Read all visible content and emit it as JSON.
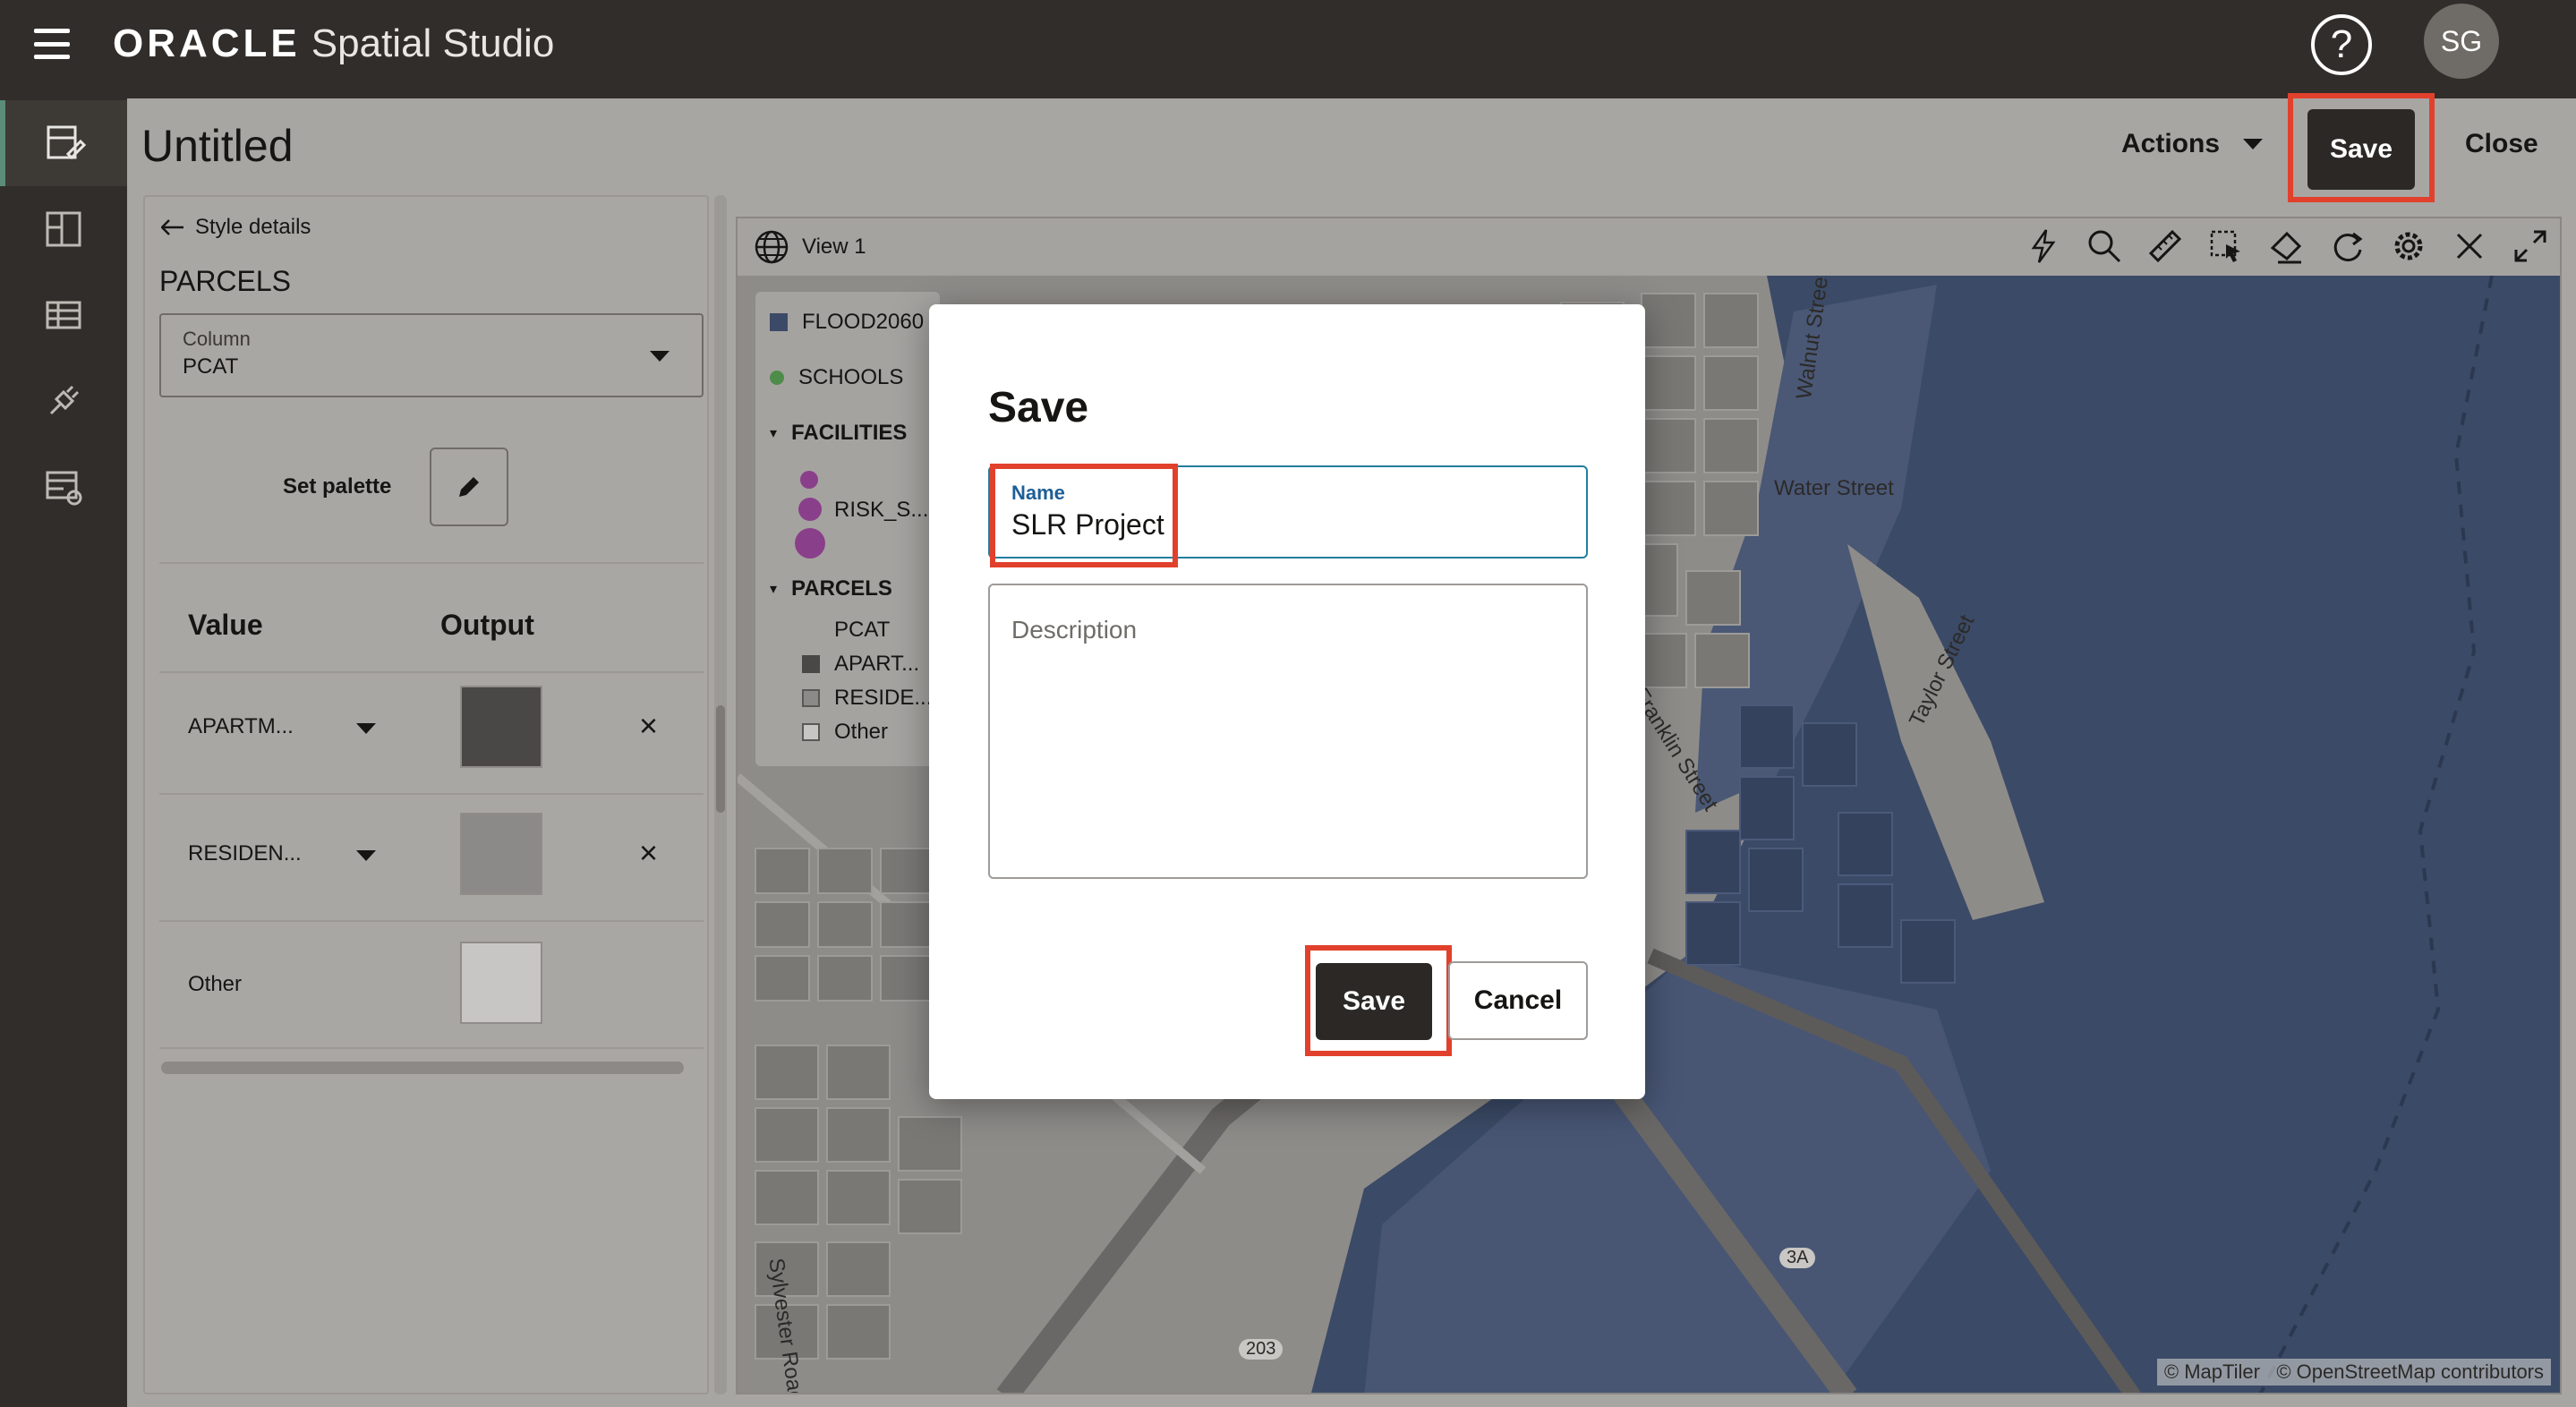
{
  "app": {
    "brand_oracle": "ORACLE",
    "brand_product": "Spatial Studio",
    "help_label": "?",
    "user_initials": "SG"
  },
  "project": {
    "title": "Untitled",
    "actions_label": "Actions",
    "save_label": "Save",
    "close_label": "Close"
  },
  "style_panel": {
    "back_label": "Style details",
    "layer_name": "PARCELS",
    "column_label": "Column",
    "column_value": "PCAT",
    "set_palette_label": "Set palette",
    "value_header": "Value",
    "output_header": "Output",
    "rows": [
      {
        "value": "APARTM...",
        "color": "#4a4847"
      },
      {
        "value": "RESIDEN...",
        "color": "#8c8a88"
      },
      {
        "value": "Other",
        "color": "#c8c6c4"
      }
    ]
  },
  "map": {
    "view_title": "View 1",
    "legend": {
      "flood": "FLOOD2060",
      "schools": "SCHOOLS",
      "facilities": "FACILITIES",
      "risk": "RISK_S...",
      "parcels": "PARCELS",
      "pcat": "PCAT",
      "apart": "APART...",
      "reside": "RESIDE...",
      "other": "Other"
    },
    "streets": {
      "water_street": "Water Street",
      "walnut_street": "Walnut Street",
      "franklin_street": "Franklin Street",
      "taylor_street": "Taylor Street",
      "sylvester_road": "Sylvester Road",
      "route_203": "203",
      "route_3a": "3A"
    },
    "attribution_maptiler": "© MapTiler",
    "attribution_osm": "© OpenStreetMap contributors",
    "colors": {
      "water": "#3b4a66",
      "land": "#8e8c89"
    }
  },
  "save_dialog": {
    "title": "Save",
    "name_label": "Name",
    "name_value": "SLR Project",
    "description_placeholder": "Description",
    "save_label": "Save",
    "cancel_label": "Cancel"
  },
  "highlight_color": "#e1412c"
}
